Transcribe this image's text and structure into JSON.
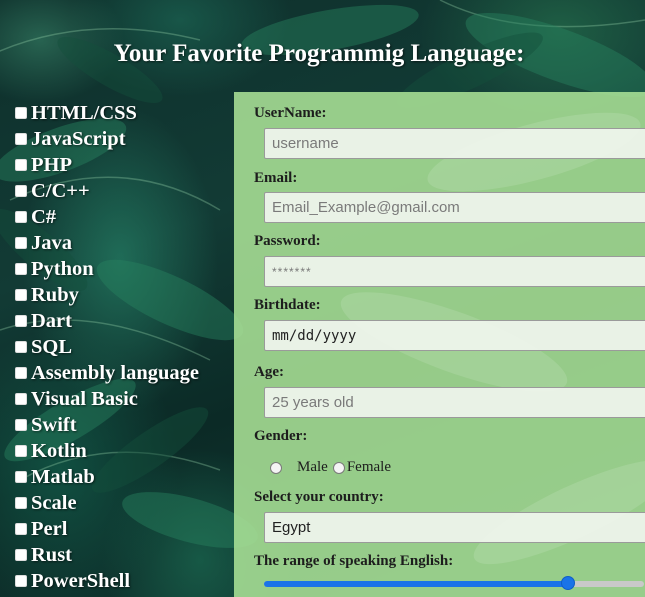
{
  "page": {
    "title": "Your Favorite Programmig Language:"
  },
  "languages": [
    "HTML/CSS",
    "JavaScript",
    "PHP",
    "C/C++",
    "C#",
    "Java",
    "Python",
    "Ruby",
    "Dart",
    "SQL",
    "Assembly language",
    "Visual Basic",
    "Swift",
    "Kotlin",
    "Matlab",
    "Scale",
    "Perl",
    "Rust",
    "PowerShell"
  ],
  "form": {
    "username": {
      "label": "UserName:",
      "placeholder": "username"
    },
    "email": {
      "label": "Email:",
      "placeholder": "Email_Example@gmail.com"
    },
    "password": {
      "label": "Password:",
      "placeholder": "*******"
    },
    "birthdate": {
      "label": "Birthdate:",
      "placeholder": "mm/dd/yyyy"
    },
    "age": {
      "label": "Age:",
      "placeholder": "25 years old"
    },
    "gender": {
      "label": "Gender:",
      "options": [
        "Male",
        "Female"
      ]
    },
    "country": {
      "label": "Select your country:",
      "value": "Egypt"
    },
    "english": {
      "label": "The range of speaking English:",
      "value_fraction": 0.8
    }
  },
  "colors": {
    "panel": "#aae196",
    "accent": "#1a73e8"
  }
}
